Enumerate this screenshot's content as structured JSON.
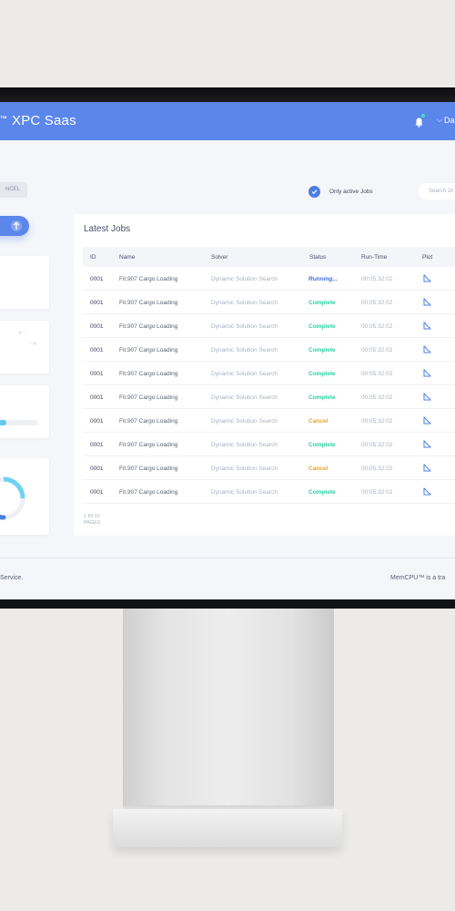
{
  "header": {
    "brand_mark": "™",
    "title": "XPC Saas",
    "user_label": "Da"
  },
  "controls": {
    "cancel_label": "NCEL",
    "only_active_label": "Only active Jobs",
    "search_placeholder": "Search Jo"
  },
  "jobs": {
    "title": "Latest Jobs",
    "columns": [
      "ID",
      "Name",
      "Solver",
      "Status",
      "Run-Time",
      "Plot"
    ],
    "rows": [
      {
        "id": "0001",
        "name": "Fit.907 Cargo Loading",
        "solver": "Dynamic Solution Search",
        "status": "Running...",
        "status_kind": "running",
        "runtime": "00:05:32:02"
      },
      {
        "id": "0001",
        "name": "Fit.907 Cargo Loading",
        "solver": "Dynamic Solution Search",
        "status": "Complete",
        "status_kind": "complete",
        "runtime": "00:05:32:02"
      },
      {
        "id": "0001",
        "name": "Fit.907 Cargo Loading",
        "solver": "Dynamic Solution Search",
        "status": "Complete",
        "status_kind": "complete",
        "runtime": "00:05:32:02"
      },
      {
        "id": "0001",
        "name": "Fit.907 Cargo Loading",
        "solver": "Dynamic Solution Search",
        "status": "Complete",
        "status_kind": "complete",
        "runtime": "00:05:32:02"
      },
      {
        "id": "0001",
        "name": "Fit.907 Cargo Loading",
        "solver": "Dynamic Solution Search",
        "status": "Complete",
        "status_kind": "complete",
        "runtime": "00:05:32:02"
      },
      {
        "id": "0001",
        "name": "Fit.907 Cargo Loading",
        "solver": "Dynamic Solution Search",
        "status": "Complete",
        "status_kind": "complete",
        "runtime": "00:05:32:02"
      },
      {
        "id": "0001",
        "name": "Fit.907 Cargo Loading",
        "solver": "Dynamic Solution Search",
        "status": "Cancel",
        "status_kind": "cancel",
        "runtime": "00:05:32:02"
      },
      {
        "id": "0001",
        "name": "Fit.907 Cargo Loading",
        "solver": "Dynamic Solution Search",
        "status": "Complete",
        "status_kind": "complete",
        "runtime": "00:05:32:02"
      },
      {
        "id": "0001",
        "name": "Fit.907 Cargo Loading",
        "solver": "Dynamic Solution Search",
        "status": "Cancel",
        "status_kind": "cancel",
        "runtime": "00:05:32:02"
      },
      {
        "id": "0001",
        "name": "Fit.907 Cargo Loading",
        "solver": "Dynamic Solution Search",
        "status": "Complete",
        "status_kind": "complete",
        "runtime": "00:05:32:02"
      }
    ],
    "pager": "1 IN 10 PAGES"
  },
  "left_cards": {
    "progress_fraction": 0.32
  },
  "footer": {
    "left": "Service.",
    "right": "MemCPU™ is a tra"
  },
  "icons": {
    "notification": "bell-icon",
    "dropdown": "chevron-down-icon",
    "only_active": "checkmark-icon",
    "upload": "arrow-up-icon",
    "plot": "plot-icon"
  },
  "colors": {
    "header": "#5b86ea",
    "running": "#3e6fd6",
    "complete": "#2ecfa6",
    "cancel": "#f0a01e"
  }
}
